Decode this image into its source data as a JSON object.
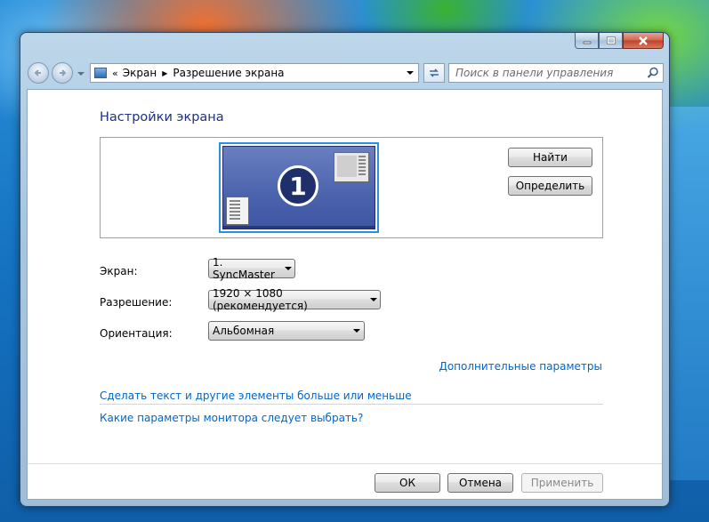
{
  "nav": {
    "breadcrumb": [
      "Экран",
      "Разрешение экрана"
    ],
    "search_placeholder": "Поиск в панели управления"
  },
  "main": {
    "title": "Настройки экрана",
    "monitor_number": "1",
    "find_button": "Найти",
    "identify_button": "Определить",
    "display_label": "Экран:",
    "display_value": "1. SyncMaster",
    "resolution_label": "Разрешение:",
    "resolution_value": "1920 × 1080 (рекомендуется)",
    "orientation_label": "Ориентация:",
    "orientation_value": "Альбомная",
    "advanced_link": "Дополнительные параметры",
    "text_size_link": "Сделать текст и другие элементы больше или меньше",
    "monitor_help_link": "Какие параметры монитора следует выбрать?"
  },
  "footer": {
    "ok": "ОК",
    "cancel": "Отмена",
    "apply": "Применить"
  },
  "colors": {
    "title": "#1e3287",
    "link": "#0066cc",
    "monitor_selection": "#2c8fe0"
  }
}
